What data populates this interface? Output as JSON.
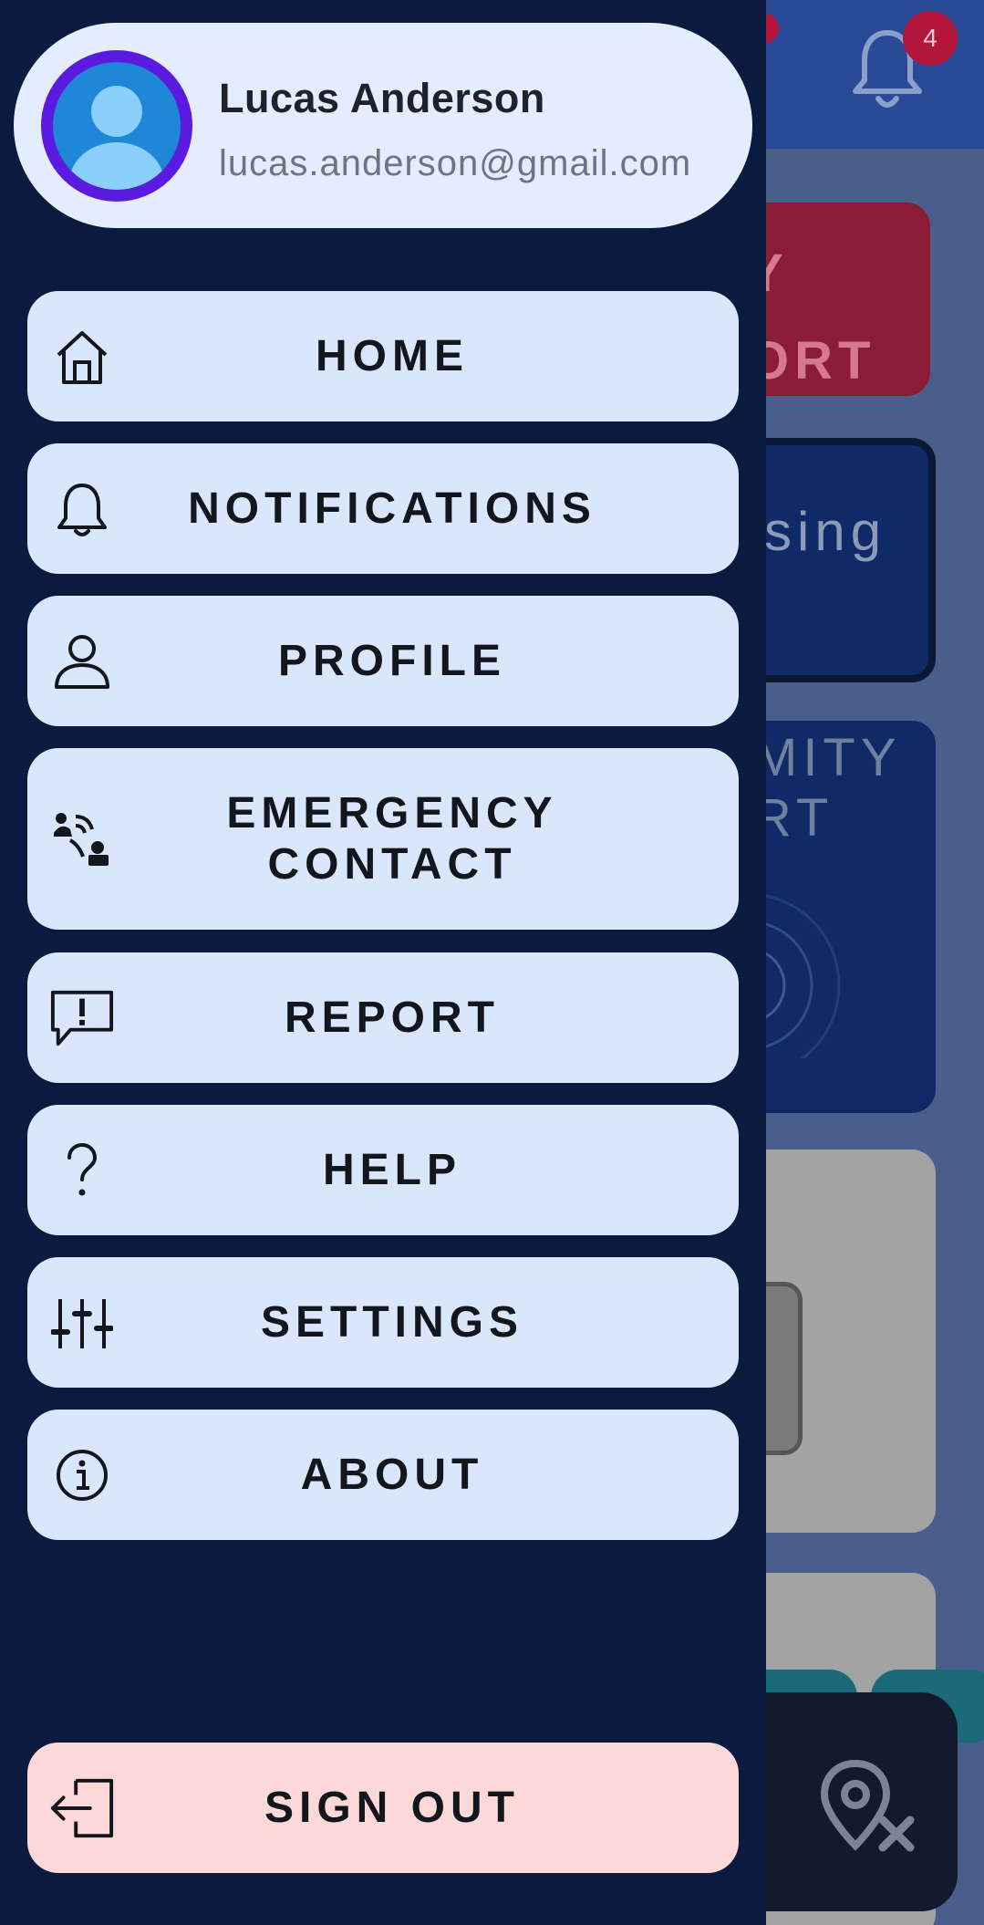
{
  "background": {
    "notification_count": "4",
    "card_red_text_line1": "Y",
    "card_red_text_line2": "ORT",
    "card_dark_text": "sing",
    "card_prox_line1": "MITY",
    "card_prox_line2": "RT",
    "icons": [
      "bell-icon",
      "location-off-icon"
    ]
  },
  "drawer": {
    "user": {
      "name": "Lucas Anderson",
      "email": "lucas.anderson@gmail.com",
      "avatar_icon": "person-icon"
    },
    "menu": [
      {
        "label": "HOME",
        "icon": "home-icon"
      },
      {
        "label": "NOTIFICATIONS",
        "icon": "bell-icon"
      },
      {
        "label": "PROFILE",
        "icon": "person-icon"
      },
      {
        "label_line1": "EMERGENCY",
        "label_line2": "CONTACT",
        "icon": "emergency-contact-icon"
      },
      {
        "label": "REPORT",
        "icon": "report-icon"
      },
      {
        "label": "HELP",
        "icon": "question-icon"
      },
      {
        "label": "SETTINGS",
        "icon": "sliders-icon"
      },
      {
        "label": "ABOUT",
        "icon": "info-icon"
      }
    ],
    "signout": {
      "label": "SIGN OUT",
      "icon": "sign-out-icon"
    }
  },
  "colors": {
    "drawer_bg": "#0b1a3f",
    "menu_item_bg": "#dae6fc",
    "signout_bg": "#fdd8d8",
    "avatar_ring": "#5b1ae0",
    "badge": "#b3153d"
  }
}
